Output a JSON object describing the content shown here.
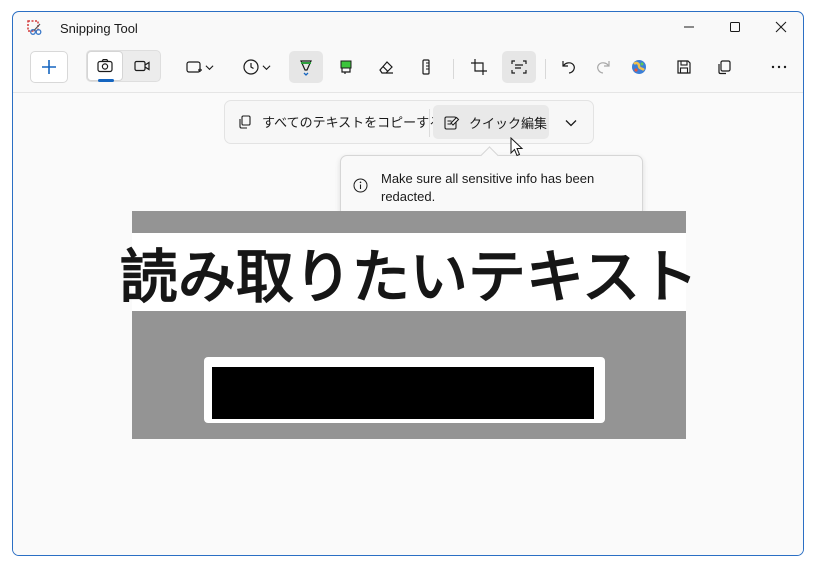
{
  "window": {
    "title": "Snipping Tool",
    "accent": "#2b6fc4"
  },
  "titlebar": {
    "minimize_icon": "minimize-icon",
    "maximize_icon": "maximize-icon",
    "close_icon": "close-icon"
  },
  "toolbar": {
    "new_label": "+",
    "tools": [
      "new",
      "photo-mode",
      "video-mode",
      "snip-shape",
      "delay",
      "ballpoint-pen",
      "highlighter",
      "eraser",
      "ruler",
      "crop",
      "text-actions",
      "undo",
      "redo",
      "paint",
      "save",
      "copy",
      "more"
    ]
  },
  "text_actions": {
    "copy_all_label": "すべてのテキストをコピーする",
    "quick_edit_label": "クイック編集"
  },
  "tooltip": {
    "message": "Make sure all sensitive info has been redacted."
  },
  "capture": {
    "heading_text": "読み取りたいテキスト"
  }
}
